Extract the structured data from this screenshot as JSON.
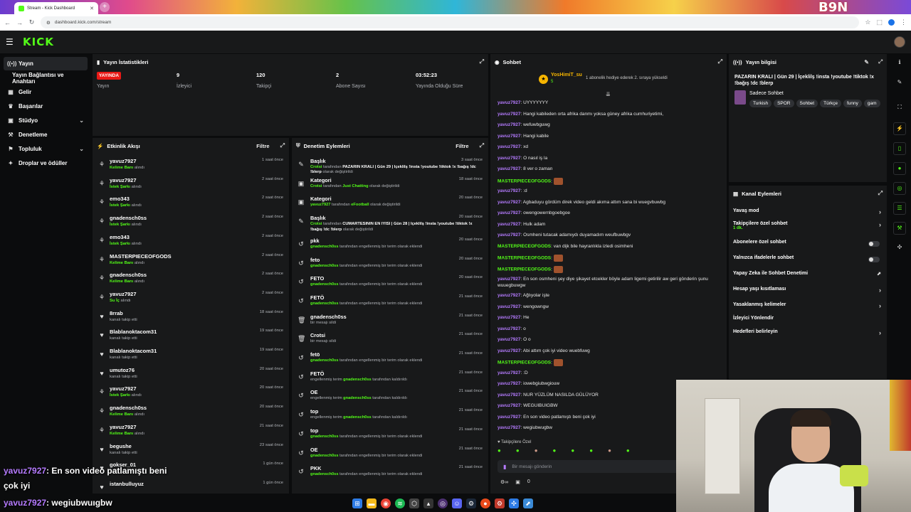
{
  "browser": {
    "tab_title": "Stream - Kick Dashboard",
    "new_tab": "+",
    "url": "dashboard.kick.com/stream",
    "corner_logo": "B9N"
  },
  "app": {
    "logo": "KICK",
    "menu_icon": "menu-icon"
  },
  "sidebar": {
    "items": [
      {
        "label": "Yayın",
        "icon": "broadcast-icon",
        "active": true
      },
      {
        "label": "Yayın Bağlantısı ve Anahtarı",
        "icon": "",
        "active": false
      },
      {
        "label": "Gelir",
        "icon": "revenue-icon",
        "active": false
      },
      {
        "label": "Başarılar",
        "icon": "trophy-icon",
        "active": false
      },
      {
        "label": "Stüdyo",
        "icon": "studio-icon",
        "active": false,
        "expandable": true
      },
      {
        "label": "Denetleme",
        "icon": "hammer-icon",
        "active": false
      },
      {
        "label": "Topluluk",
        "icon": "community-icon",
        "active": false,
        "expandable": true
      },
      {
        "label": "Droplar ve ödüller",
        "icon": "gift-icon",
        "active": false
      }
    ]
  },
  "stats": {
    "title": "Yayın İstatistikleri",
    "items": [
      {
        "value": "YAYINDA",
        "label": "Yayın"
      },
      {
        "value": "9",
        "label": "İzleyici"
      },
      {
        "value": "120",
        "label": "Takipçi"
      },
      {
        "value": "2",
        "label": "Abone Sayısı"
      },
      {
        "value": "03:52:23",
        "label": "Yayında Olduğu Süre"
      }
    ]
  },
  "activity": {
    "title": "Etkinlik Akışı",
    "filter": "Filtre",
    "rows": [
      {
        "name": "yavuz7927",
        "action": "Kelime Banı",
        "suffix": "alındı",
        "time": "1 saat önce",
        "icon": "reward-icon"
      },
      {
        "name": "yavuz7927",
        "action": "İstek Şarkı",
        "suffix": "alındı",
        "time": "2 saat önce",
        "icon": "reward-icon"
      },
      {
        "name": "emo343",
        "action": "İstek Şarkı",
        "suffix": "alındı",
        "time": "2 saat önce",
        "icon": "reward-icon"
      },
      {
        "name": "gnadensch0ss",
        "action": "İstek Şarkı",
        "suffix": "alındı",
        "time": "2 saat önce",
        "icon": "reward-icon"
      },
      {
        "name": "emo343",
        "action": "İstek Şarkı",
        "suffix": "alındı",
        "time": "2 saat önce",
        "icon": "reward-icon"
      },
      {
        "name": "MASTERPIECEOFGODS",
        "action": "Kelime Banı",
        "suffix": "alındı",
        "time": "2 saat önce",
        "icon": "reward-icon"
      },
      {
        "name": "gnadensch0ss",
        "action": "Kelime Banı",
        "suffix": "alındı",
        "time": "2 saat önce",
        "icon": "reward-icon"
      },
      {
        "name": "yavuz7927",
        "action": "Su İç",
        "suffix": "alındı",
        "time": "2 saat önce",
        "icon": "reward-icon"
      },
      {
        "name": "8rrab",
        "action": "",
        "suffix": "kanalı takip etti",
        "time": "18 saat önce",
        "icon": "heart-icon"
      },
      {
        "name": "Blablanoktacom31",
        "action": "",
        "suffix": "kanalı takip etti",
        "time": "19 saat önce",
        "icon": "heart-icon"
      },
      {
        "name": "Blablanoktacom31",
        "action": "",
        "suffix": "kanalı takip etti",
        "time": "19 saat önce",
        "icon": "heart-icon"
      },
      {
        "name": "umutoz76",
        "action": "",
        "suffix": "kanalı takip etti",
        "time": "20 saat önce",
        "icon": "heart-icon"
      },
      {
        "name": "yavuz7927",
        "action": "İstek Şarkı",
        "suffix": "alındı",
        "time": "20 saat önce",
        "icon": "reward-icon"
      },
      {
        "name": "gnadensch0ss",
        "action": "Kelime Banı",
        "suffix": "alındı",
        "time": "20 saat önce",
        "icon": "reward-icon"
      },
      {
        "name": "yavuz7927",
        "action": "Kelime Banı",
        "suffix": "alındı",
        "time": "21 saat önce",
        "icon": "reward-icon"
      },
      {
        "name": "begushe",
        "action": "",
        "suffix": "kanalı takip etti",
        "time": "23 saat önce",
        "icon": "heart-icon"
      },
      {
        "name": "gokser_01",
        "action": "",
        "suffix": "",
        "time": "1 gün önce",
        "icon": "heart-icon"
      },
      {
        "name": "istanbulluyuz",
        "action": "",
        "suffix": "",
        "time": "1 gün önce",
        "icon": "heart-icon"
      }
    ]
  },
  "moderation": {
    "title": "Denetim Eylemleri",
    "filter": "Filtre",
    "rows": [
      {
        "title": "Başlık",
        "time": "3 saat önce",
        "icon": "edit-user-icon",
        "parts": [
          [
            "g",
            "Crotsi"
          ],
          [
            "n",
            " tarafından "
          ],
          [
            "w",
            "PAZARIN KRALI | Gün 29 | İçeklilş !insta !youtube !tiktok !x !bağış !dc !blerp"
          ],
          [
            "n",
            " olarak değiştirildi"
          ]
        ]
      },
      {
        "title": "Kategori",
        "time": "18 saat önce",
        "icon": "category-icon",
        "parts": [
          [
            "g",
            "Crotsi"
          ],
          [
            "n",
            " tarafından "
          ],
          [
            "g",
            "Just Chatting"
          ],
          [
            "n",
            " olarak değiştirildi"
          ]
        ]
      },
      {
        "title": "Kategori",
        "time": "20 saat önce",
        "icon": "category-icon",
        "parts": [
          [
            "g",
            "yavuz7927"
          ],
          [
            "n",
            " tarafından "
          ],
          [
            "g",
            "eFootball"
          ],
          [
            "n",
            " olarak değiştirildi"
          ]
        ]
      },
      {
        "title": "Başlık",
        "time": "20 saat önce",
        "icon": "edit-user-icon",
        "parts": [
          [
            "g",
            "Crotsi"
          ],
          [
            "n",
            " tarafından "
          ],
          [
            "w",
            "CUMARTESİNİN EN İYİSİ | Gün 28 | İçeklilş !insta !youtube !tiktok !x !bağış !dc !blerp"
          ],
          [
            "n",
            " olarak değiştirildi"
          ]
        ]
      },
      {
        "title": "pkk",
        "time": "20 saat önce",
        "icon": "undo-icon",
        "parts": [
          [
            "g",
            "gnadensch0ss"
          ],
          [
            "n",
            " tarafından engellenmiş bir terim olarak eklendi"
          ]
        ]
      },
      {
        "title": "feto",
        "time": "20 saat önce",
        "icon": "undo-icon",
        "parts": [
          [
            "g",
            "gnadensch0ss"
          ],
          [
            "n",
            " tarafından engellenmiş bir terim olarak eklendi"
          ]
        ]
      },
      {
        "title": "FETO",
        "time": "20 saat önce",
        "icon": "undo-icon",
        "parts": [
          [
            "g",
            "gnadensch0ss"
          ],
          [
            "n",
            " tarafından engellenmiş bir terim olarak eklendi"
          ]
        ]
      },
      {
        "title": "FETÖ",
        "time": "21 saat önce",
        "icon": "undo-icon",
        "parts": [
          [
            "g",
            "gnadensch0ss"
          ],
          [
            "n",
            " tarafından engellenmiş bir terim olarak eklendi"
          ]
        ]
      },
      {
        "title": "gnadensch0ss",
        "time": "21 saat önce",
        "icon": "trash-icon",
        "parts": [
          [
            "n",
            "bir mesajı sildi"
          ]
        ]
      },
      {
        "title": "Crotsi",
        "time": "21 saat önce",
        "icon": "trash-icon",
        "parts": [
          [
            "n",
            "bir mesajı sildi"
          ]
        ]
      },
      {
        "title": "fetö",
        "time": "21 saat önce",
        "icon": "undo-icon",
        "parts": [
          [
            "g",
            "gnadensch0ss"
          ],
          [
            "n",
            " tarafından engellenmiş bir terim olarak eklendi"
          ]
        ]
      },
      {
        "title": "FETÖ",
        "time": "21 saat önce",
        "icon": "undo-icon",
        "parts": [
          [
            "n",
            "engellenmiş terim "
          ],
          [
            "g",
            "gnadensch0ss"
          ],
          [
            "n",
            " tarafından kaldırıldı"
          ]
        ]
      },
      {
        "title": "OE",
        "time": "21 saat önce",
        "icon": "undo-icon",
        "parts": [
          [
            "n",
            "engellenmiş terim "
          ],
          [
            "g",
            "gnadensch0ss"
          ],
          [
            "n",
            " tarafından kaldırıldı"
          ]
        ]
      },
      {
        "title": "top",
        "time": "21 saat önce",
        "icon": "undo-icon",
        "parts": [
          [
            "n",
            "engellenmiş terim "
          ],
          [
            "g",
            "gnadensch0ss"
          ],
          [
            "n",
            " tarafından kaldırıldı"
          ]
        ]
      },
      {
        "title": "top",
        "time": "21 saat önce",
        "icon": "undo-icon",
        "parts": [
          [
            "g",
            "gnadensch0ss"
          ],
          [
            "n",
            " tarafından engellenmiş bir terim olarak eklendi"
          ]
        ]
      },
      {
        "title": "OE",
        "time": "21 saat önce",
        "icon": "undo-icon",
        "parts": [
          [
            "g",
            "gnadensch0ss"
          ],
          [
            "n",
            " tarafından engellenmiş bir terim olarak eklendi"
          ]
        ]
      },
      {
        "title": "PKK",
        "time": "21 saat önce",
        "icon": "undo-icon",
        "parts": [
          [
            "g",
            "gnadensch0ss"
          ],
          [
            "n",
            " tarafından engellenmiş bir terim olarak eklendi"
          ]
        ]
      }
    ]
  },
  "chat": {
    "title": "Sohbet",
    "pinned": {
      "user": "YosHimiT_su",
      "count": "5",
      "text": "1 abonelik hediye ederek 2. sıraya yükseldi"
    },
    "messages": [
      {
        "user": "yavuz7927",
        "color": "purple",
        "text": "UYYYYYYY"
      },
      {
        "user": "yavuz7927",
        "color": "purple",
        "text": "Hangi kabileden orta afrika danmı yoksa güney afrika cumhuriyetimi,"
      },
      {
        "user": "yavuz7927",
        "color": "purple",
        "text": "wefuwbguwg"
      },
      {
        "user": "yavuz7927",
        "color": "purple",
        "text": "Hangi kabile"
      },
      {
        "user": "yavuz7927",
        "color": "purple",
        "text": "xd"
      },
      {
        "user": "yavuz7927",
        "color": "purple",
        "text": "O nasıl iş la"
      },
      {
        "user": "yavuz7927",
        "color": "purple",
        "text": "8 ver o zaman"
      },
      {
        "user": "MASTERPIECEOFGODS",
        "color": "green",
        "text": "",
        "emote": true
      },
      {
        "user": "yavuz7927",
        "color": "purple",
        "text": ":d"
      },
      {
        "user": "yavuz7927",
        "color": "purple",
        "text": "Agbaduyu gördüm direk video geldi akıma attım sana bi wuegvbuwbg"
      },
      {
        "user": "yavuz7927",
        "color": "purple",
        "text": "owengowernbgoebgoe"
      },
      {
        "user": "yavuz7927",
        "color": "purple",
        "text": "Hulk adam"
      },
      {
        "user": "yavuz7927",
        "color": "purple",
        "text": "Osmheni tutacak adamıydı duyamadım weufbuwbgv"
      },
      {
        "user": "MASTERPIECEOFGODS",
        "color": "green",
        "text": "van dijk bile hayranlıkla izledi osimheni"
      },
      {
        "user": "MASTERPIECEOFGODS",
        "color": "green",
        "text": "",
        "emote": true
      },
      {
        "user": "MASTERPIECEOFGODS",
        "color": "green",
        "text": "",
        "emote": true
      },
      {
        "user": "yavuz7927",
        "color": "purple",
        "text": "En son osmheni şey diye şikayet etcekler böyle adam ligemi getirilir aw geri gönderin şunu wuuegbuwgw"
      },
      {
        "user": "yavuz7927",
        "color": "purple",
        "text": "Ağlıyolar işte"
      },
      {
        "user": "yavuz7927",
        "color": "purple",
        "text": "wengowngw"
      },
      {
        "user": "yavuz7927",
        "color": "purple",
        "text": "He"
      },
      {
        "user": "yavuz7927",
        "color": "purple",
        "text": "o"
      },
      {
        "user": "yavuz7927",
        "color": "purple",
        "text": "O o"
      },
      {
        "user": "yavuz7927",
        "color": "purple",
        "text": "Abi attım çok iyi video wuebfuwg"
      },
      {
        "user": "MASTERPIECEOFGODS",
        "color": "green",
        "text": "",
        "emote": true
      },
      {
        "user": "yavuz7927",
        "color": "purple",
        "text": ":D"
      },
      {
        "user": "yavuz7927",
        "color": "purple",
        "text": "iowebgiubwgiouw"
      },
      {
        "user": "yavuz7927",
        "color": "purple",
        "text": "NUR YÜZLÜM NASILDA GÜLÜYOR"
      },
      {
        "user": "yavuz7927",
        "color": "purple",
        "text": "WEGUIBUIGBW"
      },
      {
        "user": "yavuz7927",
        "color": "purple",
        "text": "En son video patlamıştı beni çok iyi"
      },
      {
        "user": "yavuz7927",
        "color": "purple",
        "text": "wegiubwugbw"
      }
    ],
    "followers_only": "Takipçilere Özel",
    "input_placeholder": "Bir mesajı gönderin",
    "footer_count": "0"
  },
  "stream_info": {
    "title": "Yayın bilgisi",
    "stream_title": "PAZARIN KRALI | Gün 29 | İçeklilş !insta !youtube !tiktok !x !bağış !dc !blerp",
    "category": "Sadece Sohbet",
    "tags": [
      "Turkish",
      "SPOR",
      "Sohbet",
      "Türkçe",
      "funny",
      "gam"
    ]
  },
  "channel_actions": {
    "title": "Kanal Eylemleri",
    "items": [
      {
        "label": "Yavaş mod",
        "type": "arrow"
      },
      {
        "label": "Takipçilere özel sohbet",
        "sub": "1 dk.",
        "type": "arrow"
      },
      {
        "label": "Abonelere özel sohbet",
        "type": "toggle"
      },
      {
        "label": "Yalnızca ifadelerle sohbet",
        "type": "toggle"
      },
      {
        "label": "Yapay Zeka ile Sohbet Denetimi",
        "type": "external"
      },
      {
        "label": "Hesap yaşı kısıtlaması",
        "type": "arrow"
      },
      {
        "label": "Yasaklanmış kelimeler",
        "type": "arrow"
      },
      {
        "label": "İzleyici Yönlendir",
        "type": "none"
      },
      {
        "label": "Hedefleri belirleyin",
        "type": "arrow"
      }
    ]
  },
  "overlay": {
    "line1_user": "yavuz7927",
    "line1_text": ": En son video patlamıştı beni",
    "line1_cont": "çok iyi",
    "line2_user": "yavuz7927",
    "line2_text": ": wegiubwuıgbw"
  },
  "colors": {
    "accent": "#53fc18",
    "live": "#e91916",
    "chat_user": "#b57bff"
  }
}
